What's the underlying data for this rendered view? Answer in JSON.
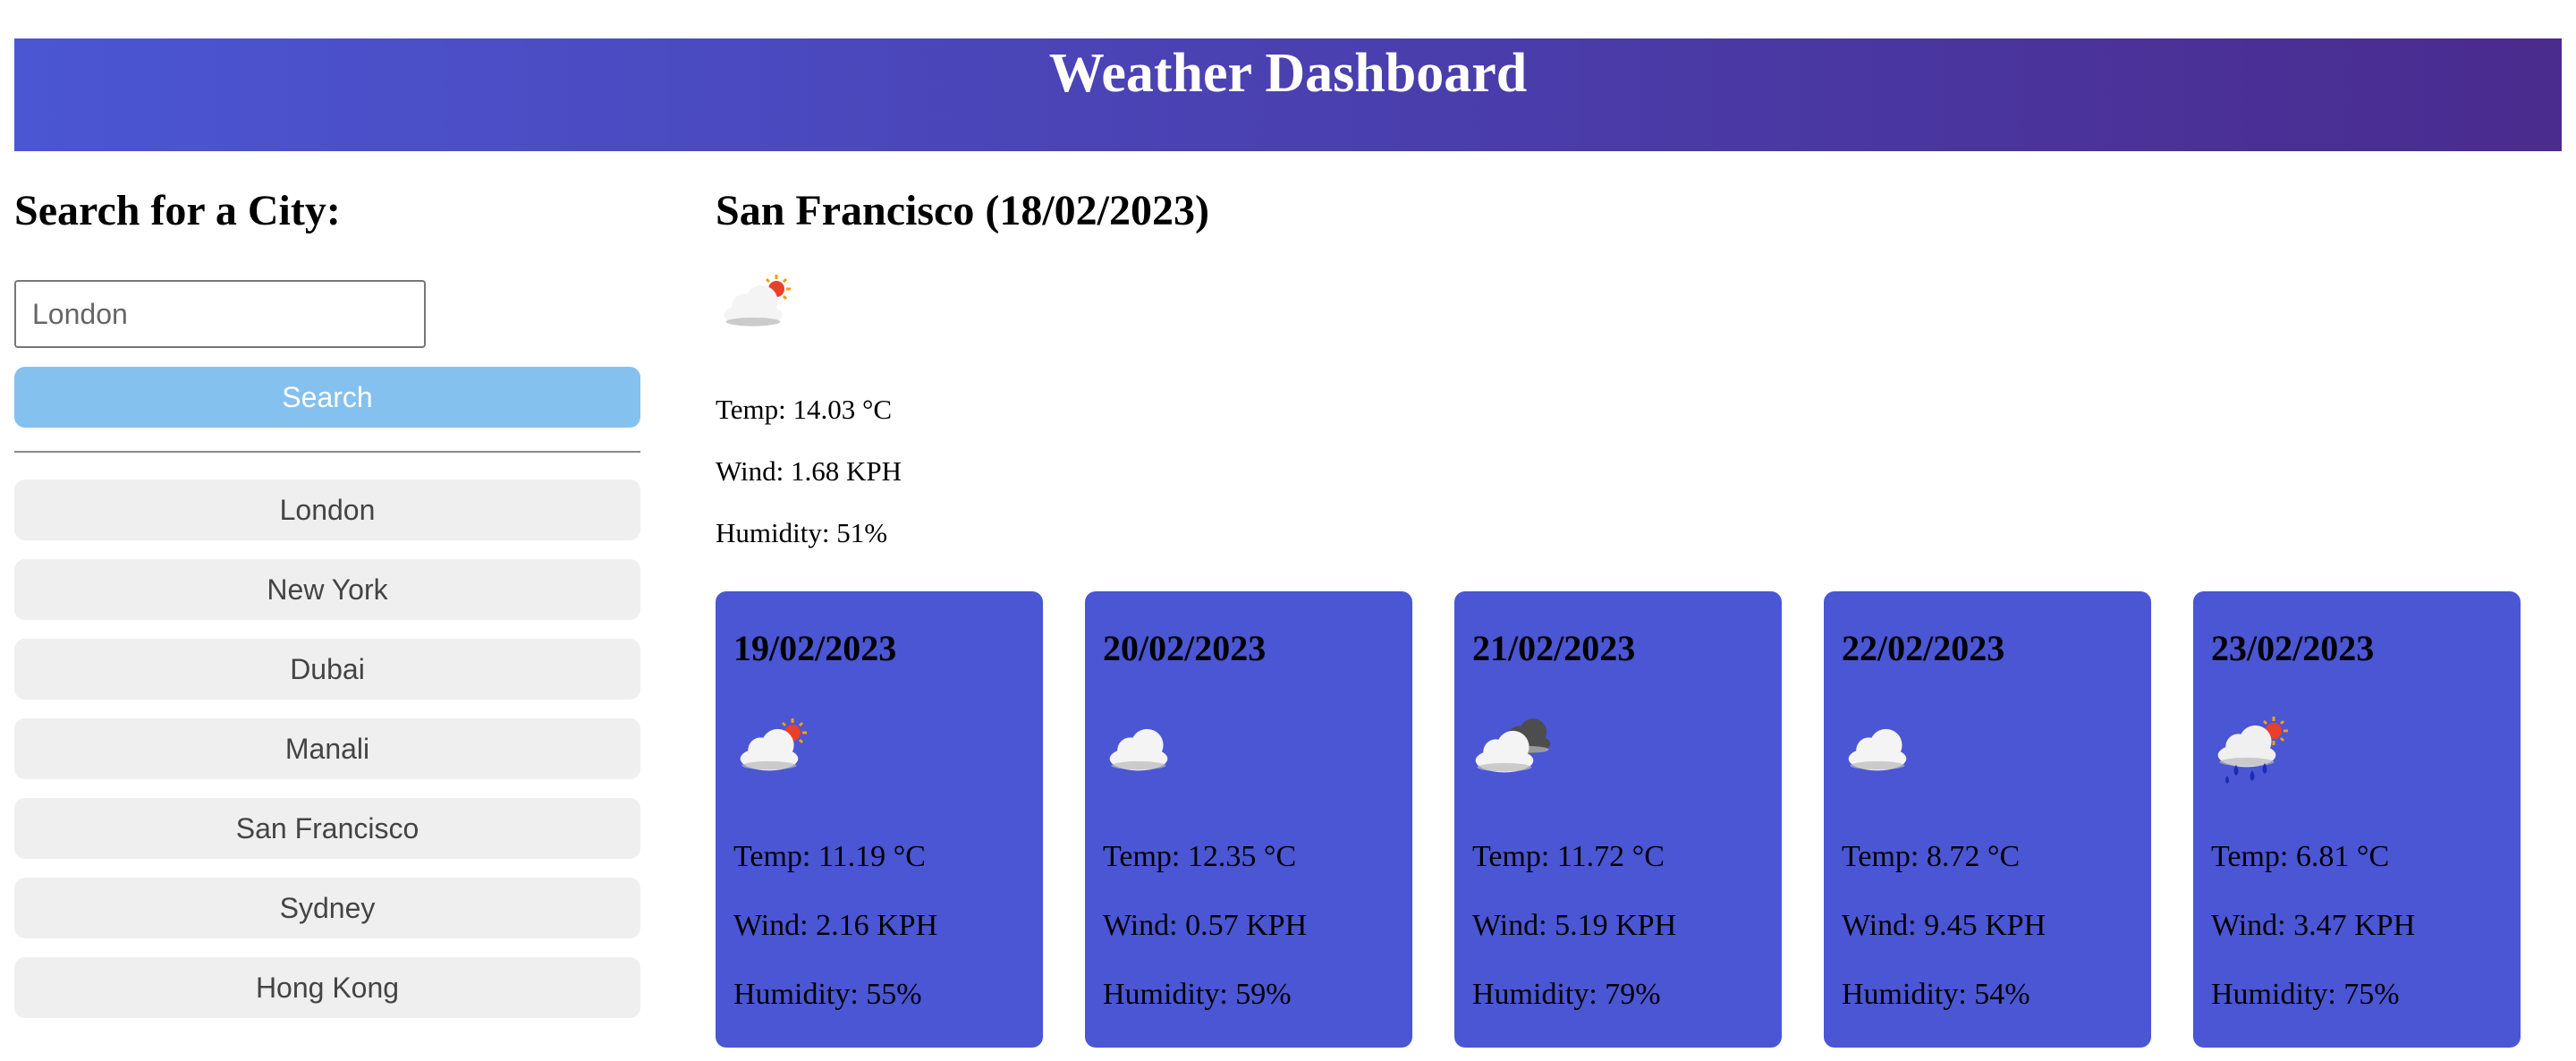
{
  "header": {
    "title": "Weather Dashboard"
  },
  "sidebar": {
    "heading": "Search for a City:",
    "search_value": "",
    "search_placeholder": "London",
    "search_button": "Search",
    "history": [
      "London",
      "New York",
      "Dubai",
      "Manali",
      "San Francisco",
      "Sydney",
      "Hong Kong"
    ]
  },
  "current": {
    "title": "San Francisco (18/02/2023)",
    "icon": "partly-cloudy-icon",
    "temp": "Temp: 14.03 °C",
    "wind": "Wind: 1.68 KPH",
    "humidity": "Humidity: 51%"
  },
  "forecast": [
    {
      "date": "19/02/2023",
      "icon": "partly-cloudy-icon",
      "temp": "Temp: 11.19 °C",
      "wind": "Wind: 2.16 KPH",
      "humidity": "Humidity: 55%"
    },
    {
      "date": "20/02/2023",
      "icon": "cloud-icon",
      "temp": "Temp: 12.35 °C",
      "wind": "Wind: 0.57 KPH",
      "humidity": "Humidity: 59%"
    },
    {
      "date": "21/02/2023",
      "icon": "broken-clouds-icon",
      "temp": "Temp: 11.72 °C",
      "wind": "Wind: 5.19 KPH",
      "humidity": "Humidity: 79%"
    },
    {
      "date": "22/02/2023",
      "icon": "cloud-icon",
      "temp": "Temp: 8.72 °C",
      "wind": "Wind: 9.45 KPH",
      "humidity": "Humidity: 54%"
    },
    {
      "date": "23/02/2023",
      "icon": "rain-sun-icon",
      "temp": "Temp: 6.81 °C",
      "wind": "Wind: 3.47 KPH",
      "humidity": "Humidity: 75%"
    }
  ],
  "colors": {
    "header_gradient_start": "#4b56d3",
    "header_gradient_end": "#4a2b8e",
    "search_button": "#85c1ef",
    "history_button": "#efefef",
    "forecast_card": "#4a56d4"
  }
}
